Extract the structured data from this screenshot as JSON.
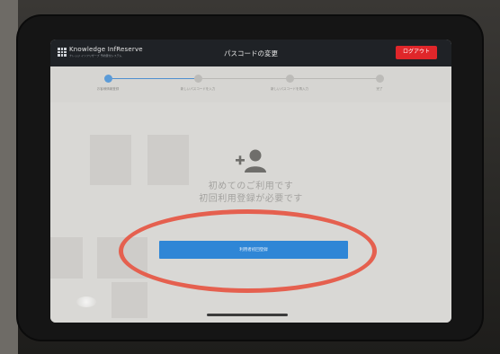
{
  "app": {
    "logo_text": "Knowledge InfReserve",
    "logo_subtext": "ナレッジ インフリザーブ 予約受付システム",
    "title": "パスコードの変更",
    "logout_label": "ログアウト"
  },
  "stepper": {
    "steps": [
      {
        "label": "お客様情報登録"
      },
      {
        "label": "新しいパスコードを入力"
      },
      {
        "label": "新しいパスコードを再入力"
      },
      {
        "label": "完了"
      }
    ]
  },
  "main": {
    "message_line1": "初めてのご利用です",
    "message_line2": "初回利用登録が必要です",
    "register_button_label": "利用者初回登録"
  },
  "colors": {
    "topbar": "#1f2226",
    "logout": "#e0262a",
    "primary": "#2f86d6",
    "annotation": "#e5604f"
  }
}
